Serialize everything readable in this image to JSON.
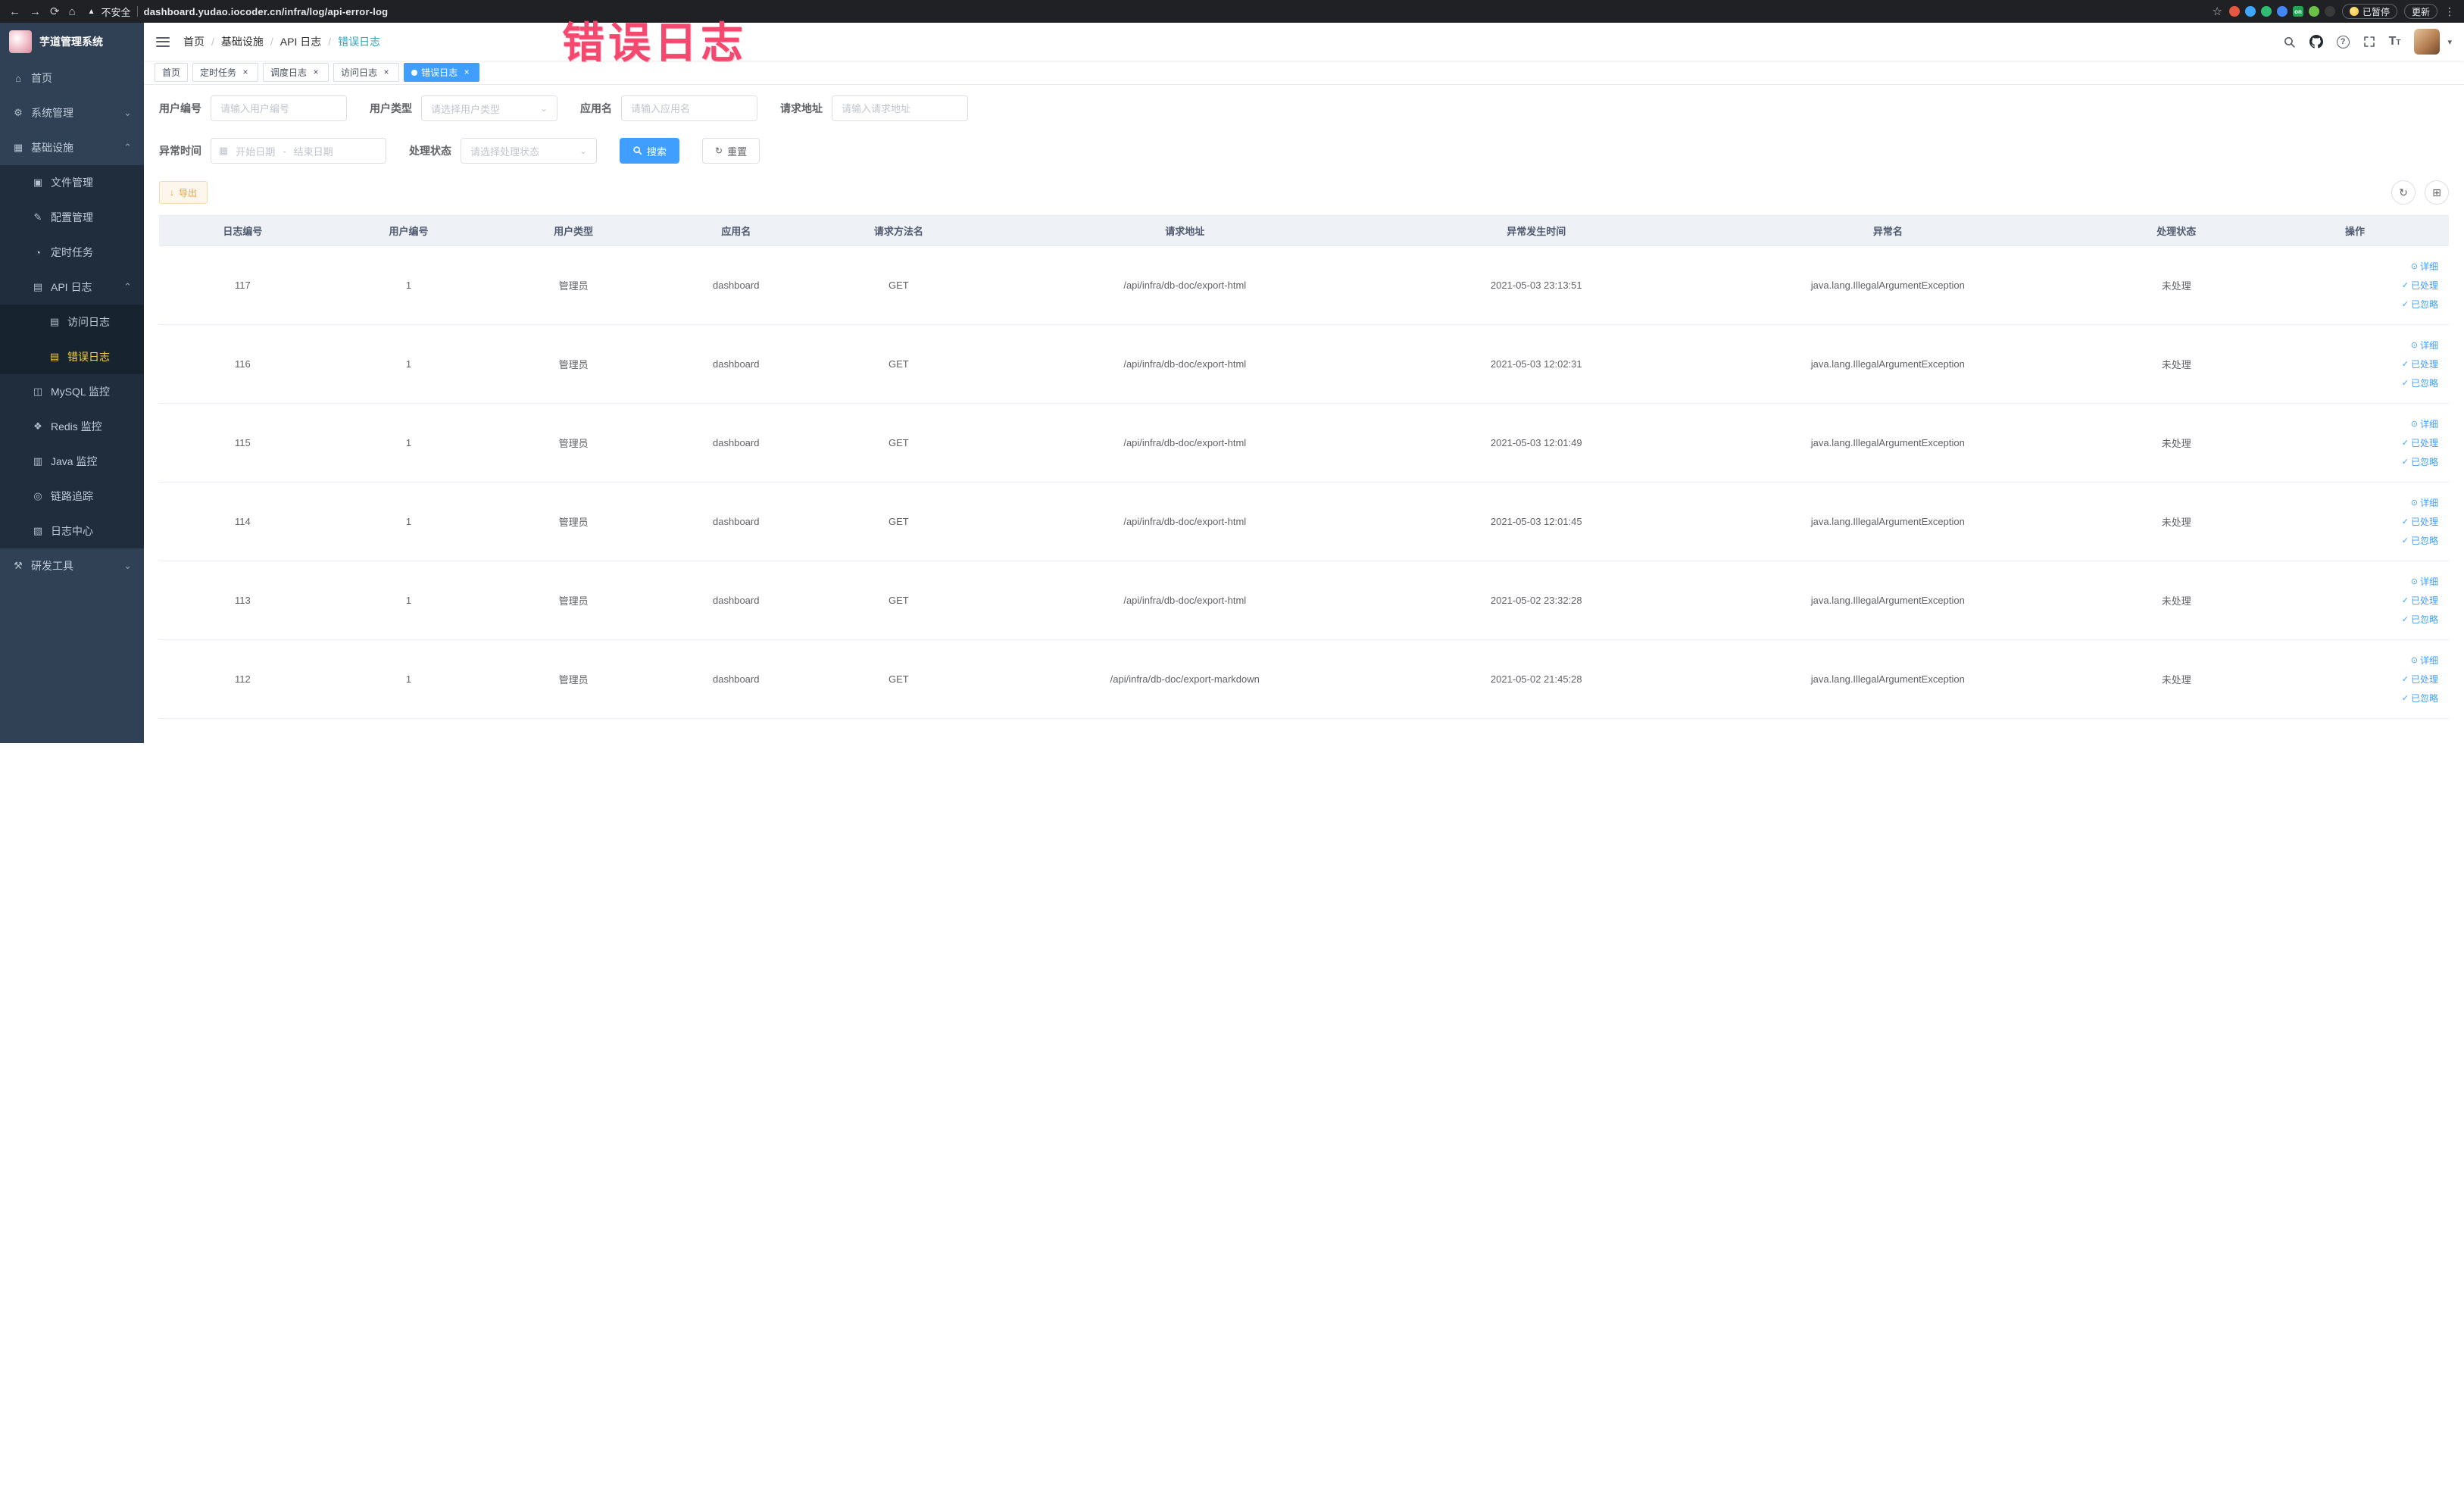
{
  "browser": {
    "security_label": "不安全",
    "url": "dashboard.yudao.iocoder.cn/infra/log/api-error-log",
    "paused_label": "已暂停",
    "update_label": "更新",
    "extensions": [
      {
        "name": "extension-icon-red",
        "color": "#e8573f"
      },
      {
        "name": "extension-icon-blue-drop",
        "color": "#3ea6ff"
      },
      {
        "name": "extension-icon-green-circle",
        "color": "#2fbd75"
      },
      {
        "name": "extension-icon-blue-grid",
        "color": "#4285f4"
      },
      {
        "name": "extension-icon-on-badge",
        "color": "#21a453",
        "text": "on"
      },
      {
        "name": "extension-icon-green-leaf",
        "color": "#6cc04a"
      },
      {
        "name": "extension-icon-dark",
        "color": "#3a3a3a"
      }
    ]
  },
  "sidebar": {
    "app_title": "芋道管理系统",
    "items": [
      {
        "key": "home",
        "label": "首页",
        "level": 1,
        "icon": "home-icon",
        "glyph": "⌂"
      },
      {
        "key": "system",
        "label": "系统管理",
        "level": 1,
        "icon": "gear-icon",
        "glyph": "⚙",
        "chevron": "down"
      },
      {
        "key": "infrastructure",
        "label": "基础设施",
        "level": 1,
        "icon": "infrastructure-icon",
        "glyph": "▦",
        "chevron": "up"
      },
      {
        "key": "file-manage",
        "label": "文件管理",
        "level": 2,
        "icon": "file-icon",
        "glyph": "▣"
      },
      {
        "key": "config-manage",
        "label": "配置管理",
        "level": 2,
        "icon": "edit-icon",
        "glyph": "✎"
      },
      {
        "key": "cron-job",
        "label": "定时任务",
        "level": 2,
        "icon": "clock-icon",
        "glyph": "◔"
      },
      {
        "key": "api-log",
        "label": "API 日志",
        "level": 2,
        "icon": "api-log-icon",
        "glyph": "▤",
        "chevron": "up"
      },
      {
        "key": "access-log",
        "label": "访问日志",
        "level": 3,
        "icon": "access-log-icon",
        "glyph": "▤"
      },
      {
        "key": "error-log",
        "label": "错误日志",
        "level": 3,
        "icon": "error-log-icon",
        "glyph": "▤",
        "active": true
      },
      {
        "key": "mysql-monitor",
        "label": "MySQL 监控",
        "level": 2,
        "icon": "mysql-icon",
        "glyph": "◫"
      },
      {
        "key": "redis-monitor",
        "label": "Redis 监控",
        "level": 2,
        "icon": "redis-icon",
        "glyph": "❖"
      },
      {
        "key": "java-monitor",
        "label": "Java 监控",
        "level": 2,
        "icon": "java-icon",
        "glyph": "▥"
      },
      {
        "key": "trace",
        "label": "链路追踪",
        "level": 2,
        "icon": "trace-icon",
        "glyph": "◎"
      },
      {
        "key": "log-center",
        "label": "日志中心",
        "level": 2,
        "icon": "log-center-icon",
        "glyph": "▧"
      },
      {
        "key": "dev-tools",
        "label": "研发工具",
        "level": 1,
        "icon": "tools-icon",
        "glyph": "⚒",
        "chevron": "down"
      }
    ]
  },
  "navbar": {
    "breadcrumbs": [
      "首页",
      "基础设施",
      "API 日志",
      "错误日志"
    ]
  },
  "tabs": [
    {
      "key": "home",
      "label": "首页",
      "closable": false,
      "active": false
    },
    {
      "key": "cron-job",
      "label": "定时任务",
      "closable": true,
      "active": false
    },
    {
      "key": "job-log",
      "label": "调度日志",
      "closable": true,
      "active": false
    },
    {
      "key": "access-log",
      "label": "访问日志",
      "closable": true,
      "active": false
    },
    {
      "key": "error-log",
      "label": "错误日志",
      "closable": true,
      "active": true
    }
  ],
  "filters": {
    "user_id": {
      "label": "用户编号",
      "placeholder": "请输入用户编号"
    },
    "user_type": {
      "label": "用户类型",
      "placeholder": "请选择用户类型"
    },
    "app_name": {
      "label": "应用名",
      "placeholder": "请输入应用名"
    },
    "request_url": {
      "label": "请求地址",
      "placeholder": "请输入请求地址"
    },
    "exception_time": {
      "label": "异常时间",
      "start_placeholder": "开始日期",
      "separator": "-",
      "end_placeholder": "结束日期"
    },
    "process_status": {
      "label": "处理状态",
      "placeholder": "请选择处理状态"
    },
    "search_label": "搜索",
    "reset_label": "重置"
  },
  "toolbar": {
    "export_label": "导出"
  },
  "table": {
    "columns": [
      {
        "key": "log_id",
        "label": "日志编号",
        "width": "7.3%"
      },
      {
        "key": "user_id",
        "label": "用户编号",
        "width": "7.2%"
      },
      {
        "key": "user_type",
        "label": "用户类型",
        "width": "7.2%"
      },
      {
        "key": "app_name",
        "label": "应用名",
        "width": "7.0%"
      },
      {
        "key": "method",
        "label": "请求方法名",
        "width": "7.2%"
      },
      {
        "key": "url",
        "label": "请求地址",
        "width": "17.8%"
      },
      {
        "key": "time",
        "label": "异常发生时间",
        "width": "12.9%"
      },
      {
        "key": "exception",
        "label": "异常名",
        "width": "17.8%"
      },
      {
        "key": "status",
        "label": "处理状态",
        "width": "7.4%"
      },
      {
        "key": "actions",
        "label": "操作",
        "width": "8.2%"
      }
    ],
    "actions": [
      {
        "key": "detail",
        "label": "详细",
        "icon": "eye-icon",
        "glyph": "⊙"
      },
      {
        "key": "processed",
        "label": "已处理",
        "icon": "check-icon",
        "glyph": "✓"
      },
      {
        "key": "ignored",
        "label": "已忽略",
        "icon": "check-icon",
        "glyph": "✓"
      }
    ],
    "rows": [
      {
        "log_id": "117",
        "user_id": "1",
        "user_type": "管理员",
        "app_name": "dashboard",
        "method": "GET",
        "url": "/api/infra/db-doc/export-html",
        "time": "2021-05-03 23:13:51",
        "exception": "java.lang.IllegalArgumentException",
        "status": "未处理"
      },
      {
        "log_id": "116",
        "user_id": "1",
        "user_type": "管理员",
        "app_name": "dashboard",
        "method": "GET",
        "url": "/api/infra/db-doc/export-html",
        "time": "2021-05-03 12:02:31",
        "exception": "java.lang.IllegalArgumentException",
        "status": "未处理"
      },
      {
        "log_id": "115",
        "user_id": "1",
        "user_type": "管理员",
        "app_name": "dashboard",
        "method": "GET",
        "url": "/api/infra/db-doc/export-html",
        "time": "2021-05-03 12:01:49",
        "exception": "java.lang.IllegalArgumentException",
        "status": "未处理"
      },
      {
        "log_id": "114",
        "user_id": "1",
        "user_type": "管理员",
        "app_name": "dashboard",
        "method": "GET",
        "url": "/api/infra/db-doc/export-html",
        "time": "2021-05-03 12:01:45",
        "exception": "java.lang.IllegalArgumentException",
        "status": "未处理"
      },
      {
        "log_id": "113",
        "user_id": "1",
        "user_type": "管理员",
        "app_name": "dashboard",
        "method": "GET",
        "url": "/api/infra/db-doc/export-html",
        "time": "2021-05-02 23:32:28",
        "exception": "java.lang.IllegalArgumentException",
        "status": "未处理"
      },
      {
        "log_id": "112",
        "user_id": "1",
        "user_type": "管理员",
        "app_name": "dashboard",
        "method": "GET",
        "url": "/api/infra/db-doc/export-markdown",
        "time": "2021-05-02 21:45:28",
        "exception": "java.lang.IllegalArgumentException",
        "status": "未处理"
      }
    ]
  },
  "annotation": {
    "text": "错误日志",
    "color": "#f4486e"
  }
}
